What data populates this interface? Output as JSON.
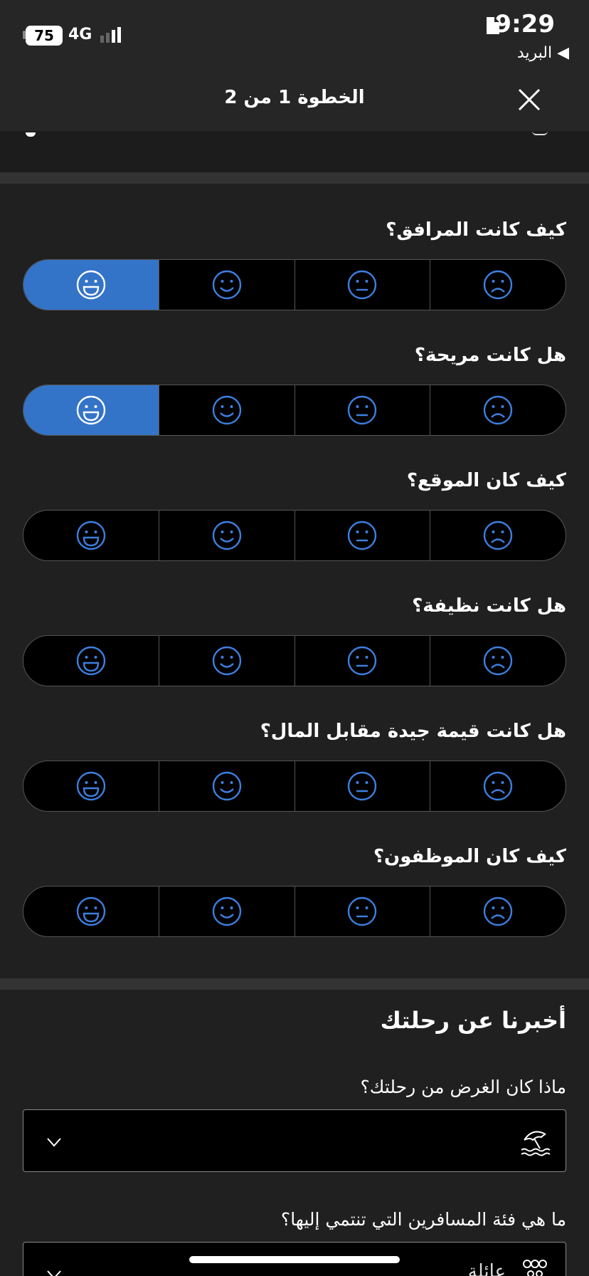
{
  "status_bar": {
    "time": "9:29",
    "back_app": "◀ البريد",
    "battery": "75",
    "network": "4G"
  },
  "header": {
    "step_title": "الخطوة 1 من 2"
  },
  "rating_questions": [
    {
      "label": "كيف كانت المرافق؟",
      "selected": "very-happy"
    },
    {
      "label": "هل كانت مريحة؟",
      "selected": "very-happy"
    },
    {
      "label": "كيف كان الموقع؟",
      "selected": null
    },
    {
      "label": "هل كانت نظيفة؟",
      "selected": null
    },
    {
      "label": "هل كانت قيمة جيدة مقابل المال؟",
      "selected": null
    },
    {
      "label": "كيف كان الموظفون؟",
      "selected": null
    }
  ],
  "trip": {
    "title": "أخبرنا عن رحلتك",
    "purpose_label": "ماذا كان الغرض من رحلتك؟",
    "purpose_value": "",
    "traveler_label": "ما هي فئة المسافرين التي تنتمي إليها؟",
    "traveler_value": "عائلة"
  },
  "colors": {
    "accent": "#3474c8",
    "face_icon": "#3d7fe0",
    "background": "#202020"
  },
  "icons": [
    "doc-icon",
    "close-icon",
    "very-happy-face-icon",
    "happy-face-icon",
    "neutral-face-icon",
    "sad-face-icon",
    "beach-umbrella-icon",
    "group-icon",
    "chevron-down-icon"
  ]
}
